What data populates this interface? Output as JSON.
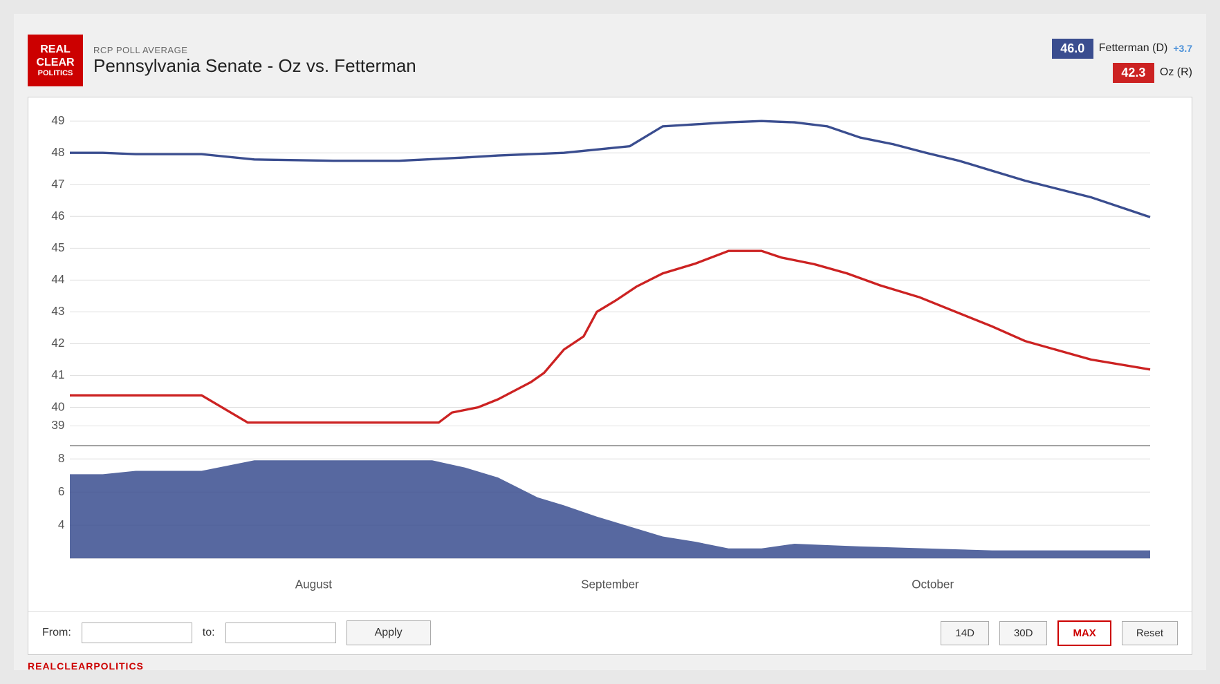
{
  "header": {
    "subtitle": "RCP POLL AVERAGE",
    "title": "Pennsylvania Senate - Oz vs. Fetterman",
    "logo_line1": "REAL",
    "logo_line2": "CLEAR",
    "logo_line3": "POLITICS"
  },
  "legend": {
    "fetterman_value": "46.0",
    "fetterman_name": "Fetterman (D)",
    "fetterman_diff": "+3.7",
    "oz_value": "42.3",
    "oz_name": "Oz (R)"
  },
  "chart": {
    "x_labels": [
      "August",
      "September",
      "October"
    ],
    "upper_y_labels": [
      "49",
      "48",
      "47",
      "46",
      "45",
      "44",
      "43",
      "42",
      "41",
      "40",
      "39"
    ],
    "lower_y_labels": [
      "8",
      "6",
      "4"
    ]
  },
  "controls": {
    "from_label": "From:",
    "to_label": "to:",
    "from_placeholder": "",
    "to_placeholder": "",
    "apply_label": "Apply",
    "btn_14d": "14D",
    "btn_30d": "30D",
    "btn_max": "MAX",
    "btn_reset": "Reset"
  },
  "footer": {
    "brand": "REALCLEARPOLITICS"
  }
}
